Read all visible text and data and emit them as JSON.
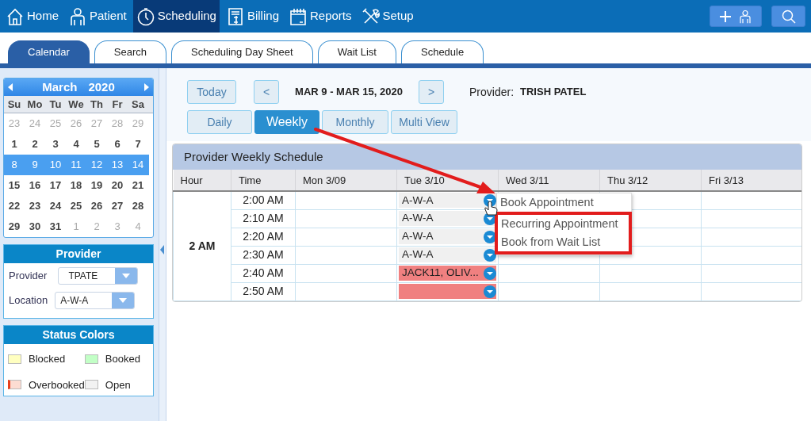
{
  "nav": {
    "items": [
      {
        "label": "Home",
        "selected": false
      },
      {
        "label": "Patient",
        "selected": false
      },
      {
        "label": "Scheduling",
        "selected": true
      },
      {
        "label": "Billing",
        "selected": false
      },
      {
        "label": "Reports",
        "selected": false
      },
      {
        "label": "Setup",
        "selected": false
      }
    ]
  },
  "tabs": [
    {
      "label": "Calendar",
      "selected": true
    },
    {
      "label": "Search",
      "selected": false
    },
    {
      "label": "Scheduling Day Sheet",
      "selected": false
    },
    {
      "label": "Wait List",
      "selected": false
    },
    {
      "label": "Schedule",
      "selected": false
    }
  ],
  "calendar": {
    "month": "March",
    "year": "2020",
    "weekdays": [
      "Su",
      "Mo",
      "Tu",
      "We",
      "Th",
      "Fr",
      "Sa"
    ],
    "weeks": [
      {
        "selected": false,
        "days": [
          {
            "day": "23",
            "other_month": true
          },
          {
            "day": "24",
            "other_month": true
          },
          {
            "day": "25",
            "other_month": true
          },
          {
            "day": "26",
            "other_month": true
          },
          {
            "day": "27",
            "other_month": true
          },
          {
            "day": "28",
            "other_month": true
          },
          {
            "day": "29",
            "other_month": true
          }
        ]
      },
      {
        "selected": false,
        "days": [
          {
            "day": "1",
            "other_month": false
          },
          {
            "day": "2",
            "other_month": false
          },
          {
            "day": "3",
            "other_month": false
          },
          {
            "day": "4",
            "other_month": false
          },
          {
            "day": "5",
            "other_month": false
          },
          {
            "day": "6",
            "other_month": false
          },
          {
            "day": "7",
            "other_month": false
          }
        ]
      },
      {
        "selected": true,
        "days": [
          {
            "day": "8",
            "other_month": false
          },
          {
            "day": "9",
            "other_month": false
          },
          {
            "day": "10",
            "other_month": false
          },
          {
            "day": "11",
            "other_month": false
          },
          {
            "day": "12",
            "other_month": false
          },
          {
            "day": "13",
            "other_month": false
          },
          {
            "day": "14",
            "other_month": false
          }
        ]
      },
      {
        "selected": false,
        "days": [
          {
            "day": "15",
            "other_month": false
          },
          {
            "day": "16",
            "other_month": false
          },
          {
            "day": "17",
            "other_month": false
          },
          {
            "day": "18",
            "other_month": false
          },
          {
            "day": "19",
            "other_month": false
          },
          {
            "day": "20",
            "other_month": false
          },
          {
            "day": "21",
            "other_month": false
          }
        ]
      },
      {
        "selected": false,
        "days": [
          {
            "day": "22",
            "other_month": false
          },
          {
            "day": "23",
            "other_month": false
          },
          {
            "day": "24",
            "other_month": false
          },
          {
            "day": "25",
            "other_month": false
          },
          {
            "day": "26",
            "other_month": false
          },
          {
            "day": "27",
            "other_month": false
          },
          {
            "day": "28",
            "other_month": false
          }
        ]
      },
      {
        "selected": false,
        "days": [
          {
            "day": "29",
            "other_month": false
          },
          {
            "day": "30",
            "other_month": false
          },
          {
            "day": "31",
            "other_month": false
          },
          {
            "day": "1",
            "other_month": true
          },
          {
            "day": "2",
            "other_month": true
          },
          {
            "day": "3",
            "other_month": true
          },
          {
            "day": "4",
            "other_month": true
          }
        ]
      }
    ]
  },
  "provider_panel": {
    "title": "Provider",
    "fields": [
      {
        "label": "Provider",
        "value": "TPATE"
      },
      {
        "label": "Location",
        "value": "A-W-A"
      }
    ]
  },
  "status_colors": {
    "title": "Status Colors",
    "items": [
      {
        "label": "Blocked",
        "color": "#ffffc0",
        "flagged": false
      },
      {
        "label": "Booked",
        "color": "#c2ffc6",
        "flagged": false
      },
      {
        "label": "Overbooked",
        "color": "#fcdcd2",
        "flagged": true
      },
      {
        "label": "Open",
        "color": "#f2f2f2",
        "flagged": false
      }
    ]
  },
  "toolbar": {
    "today": "Today",
    "prev": "<",
    "range": "MAR 9 - MAR 15, 2020",
    "next": ">",
    "provider_label": "Provider:",
    "provider_name": "TRISH PATEL"
  },
  "views": [
    {
      "label": "Daily",
      "selected": false
    },
    {
      "label": "Weekly",
      "selected": true
    },
    {
      "label": "Monthly",
      "selected": false
    },
    {
      "label": "Multi View",
      "selected": false
    }
  ],
  "schedule": {
    "title": "Provider Weekly Schedule",
    "columns": [
      "Hour",
      "Time",
      "Mon 3/09",
      "Tue 3/10",
      "Wed 3/11",
      "Thu 3/12",
      "Fri 3/13"
    ],
    "hour": "2 AM",
    "rows": [
      {
        "time": "2:00 AM",
        "slot": {
          "kind": "open",
          "text": "A-W-A"
        }
      },
      {
        "time": "2:10 AM",
        "slot": {
          "kind": "open",
          "text": "A-W-A"
        }
      },
      {
        "time": "2:20 AM",
        "slot": {
          "kind": "open",
          "text": "A-W-A"
        }
      },
      {
        "time": "2:30 AM",
        "slot": {
          "kind": "open",
          "text": "A-W-A"
        }
      },
      {
        "time": "2:40 AM",
        "slot": {
          "kind": "overbooked",
          "text": "JACK11, OLIV..."
        }
      },
      {
        "time": "2:50 AM",
        "slot": {
          "kind": "overbooked"
        }
      }
    ]
  },
  "context_menu": {
    "items": [
      {
        "label": "Book Appointment",
        "framed": false
      },
      {
        "label": "Recurring Appointment",
        "framed": true
      },
      {
        "label": "Book from Wait List",
        "framed": true
      }
    ]
  }
}
